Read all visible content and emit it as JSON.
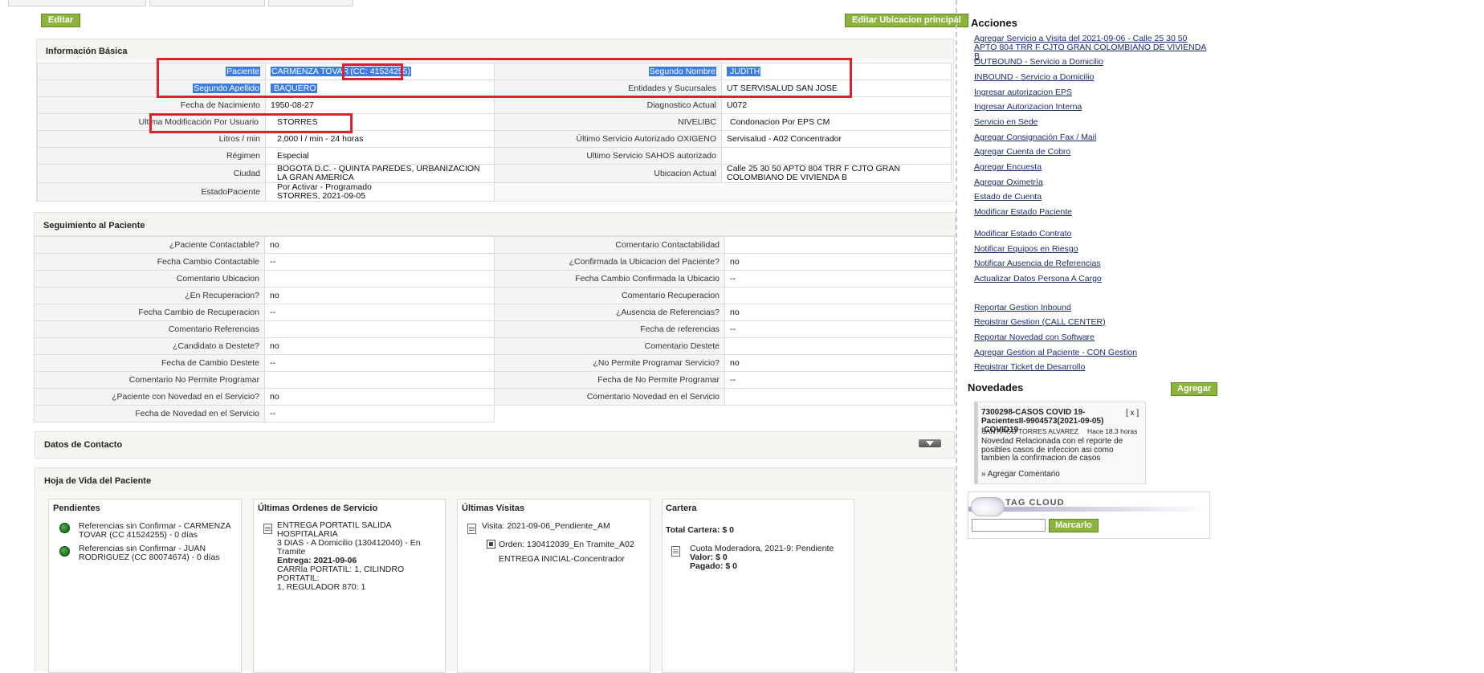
{
  "toolbar": {
    "edit_label": "Editar",
    "edit_location_label": "Editar Ubicacion principal"
  },
  "info_basica": {
    "title": "Información Básica",
    "rows": [
      {
        "l1": "Paciente",
        "v1a": "CARMENZA TOVAR",
        "v1b": "(CC: 41524255)",
        "l2": "Segundo Nombre",
        "v2": "JUDITH"
      },
      {
        "l1": "Segundo Apellido",
        "v1a": "BAQUERO",
        "l2": "Entidades y Sucursales",
        "v2": "UT SERVISALUD SAN JOSE"
      },
      {
        "l1": "Fecha de Nacimiento",
        "v1a": "1950-08-27",
        "l2": "Diagnostico Actual",
        "v2": "U072"
      },
      {
        "l1": "Ultima Modificación Por Usuario",
        "v1a": "STORRES",
        "l2": "NIVELIBC",
        "v2": "Condonacion Por EPS CM"
      },
      {
        "l1": "Litros / min",
        "v1a": "2,000 l / min - 24 horas",
        "l2": "Último Servicio Autorizado OXIGENO",
        "v2": "Servisalud - A02 Concentrador"
      },
      {
        "l1": "Régimen",
        "v1a": "Especial",
        "l2": "Ultimo Servicio SAHOS autorizado",
        "v2": ""
      },
      {
        "l1": "Ciudad",
        "v1a": "BOGOTA D.C. - QUINTA PAREDES, URBANIZACION LA GRAN AMERICA",
        "l2": "Ubicacion Actual",
        "v2": "Calle 25 30 50 APTO 804 TRR F CJTO GRAN COLOMBIANO DE VIVIENDA B"
      },
      {
        "l1": "EstadoPaciente",
        "v1a": "Por Activar - Programado",
        "v1b": "STORRES, 2021-09-05"
      }
    ]
  },
  "seguimiento": {
    "title": "Seguimiento al Paciente",
    "rows": [
      {
        "l1": "¿Paciente Contactable?",
        "v1": "no",
        "l2": "Comentario Contactabilidad",
        "v2": ""
      },
      {
        "l1": "Fecha Cambio Contactable",
        "v1": "--",
        "l2": "¿Confirmada la Ubicacion del Paciente?",
        "v2": "no"
      },
      {
        "l1": "Comentario Ubicacion",
        "v1": "",
        "l2": "Fecha Cambio Confirmada la Ubicacio",
        "v2": "--"
      },
      {
        "l1": "¿En Recuperacion?",
        "v1": "no",
        "l2": "Comentario Recuperacion",
        "v2": ""
      },
      {
        "l1": "Fecha Cambio de Recuperacion",
        "v1": "--",
        "l2": "¿Ausencia de Referencias?",
        "v2": "no"
      },
      {
        "l1": "Comentario Referencias",
        "v1": "",
        "l2": "Fecha de referencias",
        "v2": "--"
      },
      {
        "l1": "¿Candidato a Destete?",
        "v1": "no",
        "l2": "Comentario Destete",
        "v2": ""
      },
      {
        "l1": "Fecha de Cambio Destete",
        "v1": "--",
        "l2": "¿No Permite Programar Servicio?",
        "v2": "no"
      },
      {
        "l1": "Comentario No Permite Programar",
        "v1": "",
        "l2": "Fecha de No Permite Programar",
        "v2": "--"
      },
      {
        "l1": "¿Paciente con Novedad en el Servicio?",
        "v1": "no",
        "l2": "Comentario Novedad en el Servicio",
        "v2": ""
      },
      {
        "l1": "Fecha de Novedad en el Servicio",
        "v1": "--"
      }
    ]
  },
  "contacto": {
    "title": "Datos de Contacto"
  },
  "hoja_vida": {
    "title": "Hoja de Vida del Paciente",
    "pendientes": {
      "title": "Pendientes",
      "items": [
        {
          "line1": "Referencias sin Confirmar - CARMENZA",
          "line2": "TOVAR (CC 41524255) - 0 días"
        },
        {
          "line1": "Referencias sin Confirmar - JUAN",
          "line2": "RODRIGUEZ (CC 80074674) - 0 días"
        }
      ]
    },
    "ordenes": {
      "title": "Últimas Ordenes de Servicio",
      "line1": "ENTREGA PORTATIL SALIDA HOSPITALARIA",
      "line2": "3 DIAS - A Domicilio (130412040) - En Tramite",
      "line3": "Entrega: 2021-09-06",
      "line4": "CARRla PORTATIL: 1, CILINDRO PORTATIL:",
      "line5": "1, REGULADOR 870: 1"
    },
    "visitas": {
      "title": "Últimas Visitas",
      "visita": "Visita: 2021-09-06_Pendiente_AM",
      "orden": "Orden: 130412039_En Tramite_A02",
      "orden2": "ENTREGA INICIAL-Concentrador"
    },
    "cartera": {
      "title": "Cartera",
      "total": "Total Cartera: $ 0",
      "cuota": "Cuota Moderadora, 2021-9: Pendiente",
      "valor": "Valor: $ 0",
      "pagado": "Pagado: $ 0"
    }
  },
  "acciones": {
    "title": "Acciones",
    "links": [
      "Agregar Servicio a Visita del 2021-09-06 - Calle 25 30 50 APTO 804 TRR F CJTO GRAN COLOMBIANO DE VIVIENDA B",
      "OUTBOUND - Servicio a Domicilio",
      "INBOUND - Servicio a Domicilio",
      "Ingresar autorizacion EPS",
      "Ingresar Autorizacion Interna",
      "Servicio en Sede",
      "Agregar Consignación Fax / Mail",
      "Agregar Cuenta de Cobro",
      "Agregar Encuesta",
      "Agregar Oximetría",
      "Estado de Cuenta",
      "Modificar Estado Paciente",
      "Modificar Estado Contrato",
      "Notificar Equipos en Riesgo",
      "Notificar Ausencia de Referencias",
      "Actualizar Datos Persona A Cargo",
      "Reportar Gestion Inbound",
      "Registrar Gestion (CALL CENTER)",
      "Reportar Novedad con Software",
      "Agregar Gestion al Paciente - CON Gestion",
      "Registrar Ticket de Desarrollo"
    ]
  },
  "novedades": {
    "title": "Novedades",
    "add_label": "Agregar",
    "item": {
      "title": "7300298-CASOS COVID 19-PacientesII-9904573(2021-09-05) :COVID19",
      "close": "[ x ]",
      "author": "SANTIAGO TORRES ALVAREZ",
      "time": "Hace 18.3 horas",
      "body": "Novedad Relacionada con el reporte de posibles casos de infeccion asi como tambien la confirmacion de casos",
      "comment": "» Agregar Comentario"
    }
  },
  "tagcloud": {
    "title": "TAG CLOUD",
    "button": "Marcarlo",
    "input_value": ""
  }
}
